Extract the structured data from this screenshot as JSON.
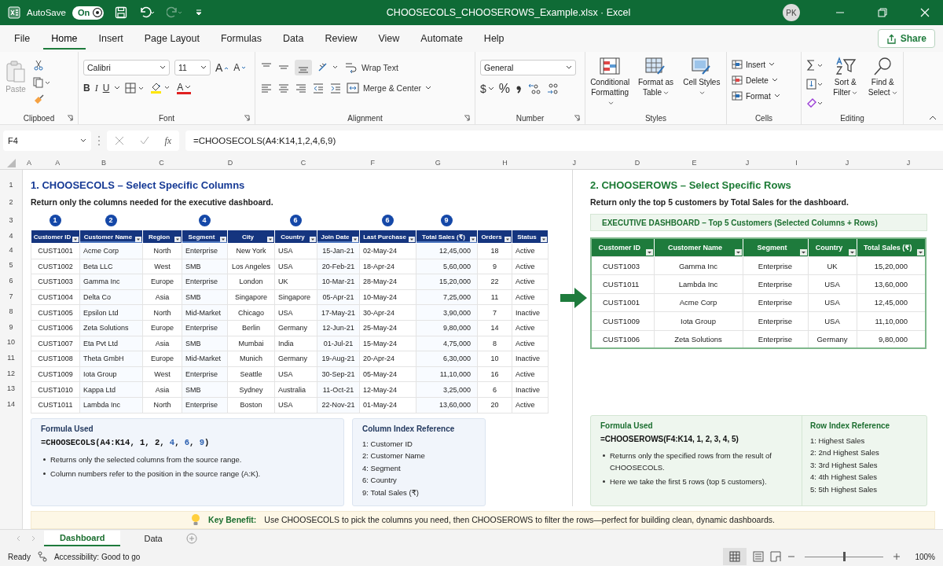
{
  "titlebar": {
    "autosave_label": "AutoSave",
    "autosave": {
      "label": "On",
      "on": true
    },
    "title": "CHOOSECOLS_CHOOSEROWS_Example.xlsx  ·  Excel",
    "user_initials": "PK"
  },
  "menu_tabs": [
    {
      "label": "File",
      "selected": false
    },
    {
      "label": "Home",
      "selected": true
    },
    {
      "label": "Insert",
      "selected": false
    },
    {
      "label": "Page Layout",
      "selected": false
    },
    {
      "label": "Formulas",
      "selected": false
    },
    {
      "label": "Data",
      "selected": false
    },
    {
      "label": "Review",
      "selected": false
    },
    {
      "label": "View",
      "selected": false
    },
    {
      "label": "Automate",
      "selected": false
    },
    {
      "label": "Help",
      "selected": false
    }
  ],
  "share_button": "Share",
  "ribbon": {
    "clipboard": {
      "paste": "Paste",
      "group": "Clipboed"
    },
    "font": {
      "name": "Calibri",
      "size": "11",
      "grow": "A",
      "shrink": "A",
      "bold": "B",
      "italic": "I",
      "underline": "U",
      "font_color_label": "A",
      "group": "Font"
    },
    "alignment": {
      "wrap": "Wrap Text",
      "merge": "Merge & Center",
      "group": "Alignment"
    },
    "number": {
      "format": "General",
      "currency": "$",
      "percent": "%",
      "group": "Number"
    },
    "styles": {
      "buttons": [
        "Conditional Formatting",
        "Format as Table",
        "Cell Styles"
      ],
      "group": "Styles"
    },
    "cells": {
      "buttons": [
        "Insert",
        "Delete",
        "Format"
      ],
      "group": "Cells"
    },
    "editing": {
      "buttons": [
        "Sort & Filter",
        "Find & Select"
      ],
      "group": "Editing"
    }
  },
  "formula_bar": {
    "name_box": "F4",
    "fx": "fx",
    "formula": "=CHOOSECOLS(A4:K14,1,2,4,6,9)"
  },
  "column_letters": [
    "A",
    "A",
    "B",
    "C",
    "D",
    "C",
    "F",
    "G",
    "H",
    "J",
    "D",
    "E",
    "J",
    "I",
    "J",
    "J"
  ],
  "row_numbers": [
    "1",
    "2",
    "3",
    "4",
    "4",
    "5",
    "6",
    "7",
    "8",
    "9",
    "10",
    "11",
    "12",
    "13",
    "14"
  ],
  "left": {
    "title": "1. CHOOSECOLS – Select Specific Columns",
    "subtitle": "Return only the columns needed for the executive dashboard.",
    "table": {
      "columns": [
        {
          "label": "Customer ID",
          "badge": "1",
          "marked": false
        },
        {
          "label": "Customer Name",
          "badge": "2",
          "marked": true
        },
        {
          "label": "Region",
          "marked": false
        },
        {
          "label": "Segment",
          "badge": "4",
          "marked": true
        },
        {
          "label": "City",
          "marked": false
        },
        {
          "label": "Country",
          "badge": "6",
          "marked": false
        },
        {
          "label": "Join Date",
          "marked": true
        },
        {
          "label": "Last Purchase",
          "badge": "6",
          "marked": false
        },
        {
          "label": "Total Sales (₹)",
          "badge": "9",
          "marked": true
        },
        {
          "label": "Orders",
          "marked": false
        },
        {
          "label": "Status",
          "marked": false
        }
      ],
      "rows": [
        [
          "CUST1001",
          "Acme Corp",
          "North",
          "Enterprise",
          "New York",
          "USA",
          "15-Jan-21",
          "02-May-24",
          "12,45,000",
          "18",
          "Active"
        ],
        [
          "CUST1002",
          "Beta LLC",
          "West",
          "SMB",
          "Los Angeles",
          "USA",
          "20-Feb-21",
          "18-Apr-24",
          "5,60,000",
          "9",
          "Active"
        ],
        [
          "CUST1003",
          "Gamma Inc",
          "Europe",
          "Enterprise",
          "London",
          "UK",
          "10-Mar-21",
          "28-May-24",
          "15,20,000",
          "22",
          "Active"
        ],
        [
          "CUST1004",
          "Delta Co",
          "Asia",
          "SMB",
          "Singapore",
          "Singapore",
          "05-Apr-21",
          "10-May-24",
          "7,25,000",
          "11",
          "Active"
        ],
        [
          "CUST1005",
          "Epsilon Ltd",
          "North",
          "Mid-Market",
          "Chicago",
          "USA",
          "17-May-21",
          "30-Apr-24",
          "3,90,000",
          "7",
          "Inactive"
        ],
        [
          "CUST1006",
          "Zeta Solutions",
          "Europe",
          "Enterprise",
          "Berlin",
          "Germany",
          "12-Jun-21",
          "25-May-24",
          "9,80,000",
          "14",
          "Active"
        ],
        [
          "CUST1007",
          "Eta Pvt Ltd",
          "Asia",
          "SMB",
          "Mumbai",
          "India",
          "01-Jul-21",
          "15-May-24",
          "4,75,000",
          "8",
          "Active"
        ],
        [
          "CUST1008",
          "Theta GmbH",
          "Europe",
          "Mid-Market",
          "Munich",
          "Germany",
          "19-Aug-21",
          "20-Apr-24",
          "6,30,000",
          "10",
          "Inactive"
        ],
        [
          "CUST1009",
          "Iota Group",
          "West",
          "Enterprise",
          "Seattle",
          "USA",
          "30-Sep-21",
          "05-May-24",
          "11,10,000",
          "16",
          "Active"
        ],
        [
          "CUST1010",
          "Kappa Ltd",
          "Asia",
          "SMB",
          "Sydney",
          "Australia",
          "11-Oct-21",
          "12-May-24",
          "3,25,000",
          "6",
          "Inactive"
        ],
        [
          "CUST1011",
          "Lambda Inc",
          "North",
          "Enterprise",
          "Boston",
          "USA",
          "22-Nov-21",
          "01-May-24",
          "13,60,000",
          "20",
          "Active"
        ]
      ]
    },
    "formula_box": {
      "title": "Formula Used",
      "formula": [
        {
          "text": "=CHOOSECOLS(A4:K14, 1, 2, ",
          "highlight": false
        },
        {
          "text": "4",
          "highlight": true
        },
        {
          "text": ", ",
          "highlight": false
        },
        {
          "text": "6",
          "highlight": true
        },
        {
          "text": ", ",
          "highlight": false
        },
        {
          "text": "9",
          "highlight": true
        },
        {
          "text": ")",
          "highlight": false
        }
      ],
      "bullets": [
        "Returns only the selected columns from the source range.",
        "Column numbers refer to the position in the source range (A:K)."
      ]
    },
    "index_box": {
      "title": "Column Index Reference",
      "items": [
        "1: Customer ID",
        "2: Customer Name",
        "4: Segment",
        "6: Country",
        "9: Total Sales (₹)"
      ]
    }
  },
  "right": {
    "title": "2. CHOOSEROWS – Select Specific Rows",
    "subtitle": "Return only the top 5 customers by Total Sales for the dashboard.",
    "banner": "EXECUTIVE DASHBOARD – Top 5 Customers (Selected Columns + Rows)",
    "table": {
      "columns": [
        "Customer ID",
        "Customer Name",
        "Segment",
        "Country",
        "Total Sales (₹)"
      ],
      "rows": [
        [
          "CUST1003",
          "Gamma Inc",
          "Enterprise",
          "UK",
          "15,20,000"
        ],
        [
          "CUST1011",
          "Lambda Inc",
          "Enterprise",
          "USA",
          "13,60,000"
        ],
        [
          "CUST1001",
          "Acme Corp",
          "Enterprise",
          "USA",
          "12,45,000"
        ],
        [
          "CUST1009",
          "Iota Group",
          "Enterprise",
          "USA",
          "11,10,000"
        ],
        [
          "CUST1006",
          "Zeta Solutions",
          "Enterprise",
          "Germany",
          "9,80,000"
        ]
      ]
    },
    "formula_box": {
      "title": "Formula Used",
      "formula": "=CHOOSEROWS(F4:K14, 1, 2, 3, 4, 5)",
      "bullets": [
        "Returns only the specified rows from the result of CHOOSECOLS.",
        "Here we take the first 5 rows (top 5 customers)."
      ]
    },
    "index_box": {
      "title": "Row Index Reference",
      "items": [
        "1: Highest Sales",
        "2: 2nd Highest Sales",
        "3: 3rd Highest Sales",
        "4: 4th Highest Sales",
        "5: 5th Highest Sales"
      ]
    }
  },
  "key_benefit": {
    "label": "Key Benefit:",
    "text": "Use CHOOSECOLS to pick the columns you need, then CHOOSEROWS to filter the rows—perfect for building clean, dynamic dashboards."
  },
  "sheet_tabs": [
    {
      "label": "Dashboard",
      "selected": true
    },
    {
      "label": "Data",
      "selected": false
    }
  ],
  "status_bar": {
    "ready": "Ready",
    "accessibility": "Accessibility: Good to go",
    "zoom": {
      "level": 0.5,
      "reading": "100%"
    }
  }
}
